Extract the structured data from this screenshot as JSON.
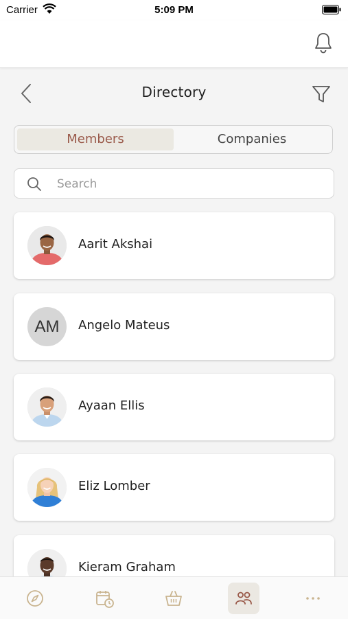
{
  "status_bar": {
    "carrier": "Carrier",
    "time": "5:09 PM"
  },
  "nav": {
    "title": "Directory"
  },
  "segments": {
    "members": "Members",
    "companies": "Companies",
    "selected": "Members"
  },
  "search": {
    "placeholder": "Search",
    "value": ""
  },
  "members": [
    {
      "name": "Aarit Akshai",
      "avatar": "photo",
      "shirt": "#e46a6a"
    },
    {
      "name": "Angelo Mateus",
      "avatar": "initials",
      "initials": "AM"
    },
    {
      "name": "Ayaan Ellis",
      "avatar": "photo",
      "shirt": "#bcd6ee"
    },
    {
      "name": "Eliz Lomber",
      "avatar": "photo",
      "shirt": "#2f7fd6"
    },
    {
      "name": "Kieram Graham",
      "avatar": "photo",
      "shirt": "#9fc8ea"
    }
  ],
  "tabs": [
    {
      "name": "explore",
      "icon": "compass-icon"
    },
    {
      "name": "calendar",
      "icon": "calendar-clock-icon"
    },
    {
      "name": "shop",
      "icon": "basket-icon"
    },
    {
      "name": "directory",
      "icon": "people-icon",
      "active": true
    },
    {
      "name": "more",
      "icon": "more-dots-icon"
    }
  ],
  "colors": {
    "accent": "#9a5a4a",
    "tab_icon": "#c9b48f",
    "active_tab_bg": "#ebe8e2"
  }
}
